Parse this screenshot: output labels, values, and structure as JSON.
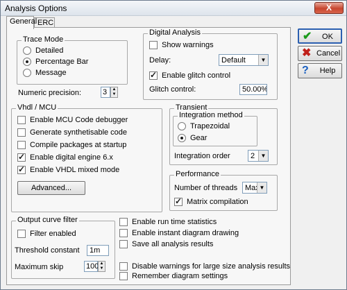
{
  "window": {
    "title": "Analysis Options",
    "close_label": "X"
  },
  "tabs": [
    {
      "label": "General"
    },
    {
      "label": "ERC"
    }
  ],
  "trace_mode": {
    "legend": "Trace Mode",
    "options": [
      "Detailed",
      "Percentage Bar",
      "Message"
    ],
    "selected": "Percentage Bar"
  },
  "numeric_precision": {
    "label": "Numeric precision:",
    "value": "3"
  },
  "digital_analysis": {
    "legend": "Digital Analysis",
    "show_warnings": {
      "label": "Show warnings",
      "checked": false
    },
    "delay": {
      "label": "Delay:",
      "value": "Default"
    },
    "enable_glitch": {
      "label": "Enable glitch control",
      "checked": true
    },
    "glitch_control": {
      "label": "Glitch control:",
      "value": "50.00%"
    }
  },
  "vhdl_mcu": {
    "legend": "Vhdl / MCU",
    "items": [
      {
        "label": "Enable MCU Code debugger",
        "checked": false
      },
      {
        "label": "Generate synthetisable code",
        "checked": false
      },
      {
        "label": "Compile packages at startup",
        "checked": false
      },
      {
        "label": "Enable digital engine 6.x",
        "checked": true
      },
      {
        "label": "Enable VHDL mixed mode",
        "checked": true
      }
    ],
    "advanced_label": "Advanced..."
  },
  "transient": {
    "legend": "Transient",
    "integration_legend": "Integration method",
    "methods": [
      "Trapezoidal",
      "Gear"
    ],
    "selected": "Gear",
    "order_label": "Integration order",
    "order_value": "2"
  },
  "performance": {
    "legend": "Performance",
    "threads_label": "Number of threads",
    "threads_value": "Max",
    "matrix": {
      "label": "Matrix compilation",
      "checked": true
    }
  },
  "output_filter": {
    "legend": "Output curve filter",
    "filter_enabled": {
      "label": "Filter enabled",
      "checked": false
    },
    "threshold": {
      "label": "Threshold constant",
      "value": "1m"
    },
    "max_skip": {
      "label": "Maximum skip",
      "value": "100"
    }
  },
  "misc": [
    {
      "label": "Enable run time statistics",
      "checked": false
    },
    {
      "label": "Enable instant diagram drawing",
      "checked": false
    },
    {
      "label": "Save all analysis results",
      "checked": false
    },
    {
      "label": "Disable warnings for large size analysis results",
      "checked": false
    },
    {
      "label": "Remember diagram settings",
      "checked": false
    }
  ],
  "buttons": {
    "ok": {
      "label": "OK",
      "icon": "check-icon",
      "color": "#1a9a1a"
    },
    "cancel": {
      "label": "Cancel",
      "icon": "x-icon",
      "color": "#c0201a"
    },
    "help": {
      "label": "Help",
      "icon": "question-icon",
      "color": "#1a5fc0"
    }
  }
}
